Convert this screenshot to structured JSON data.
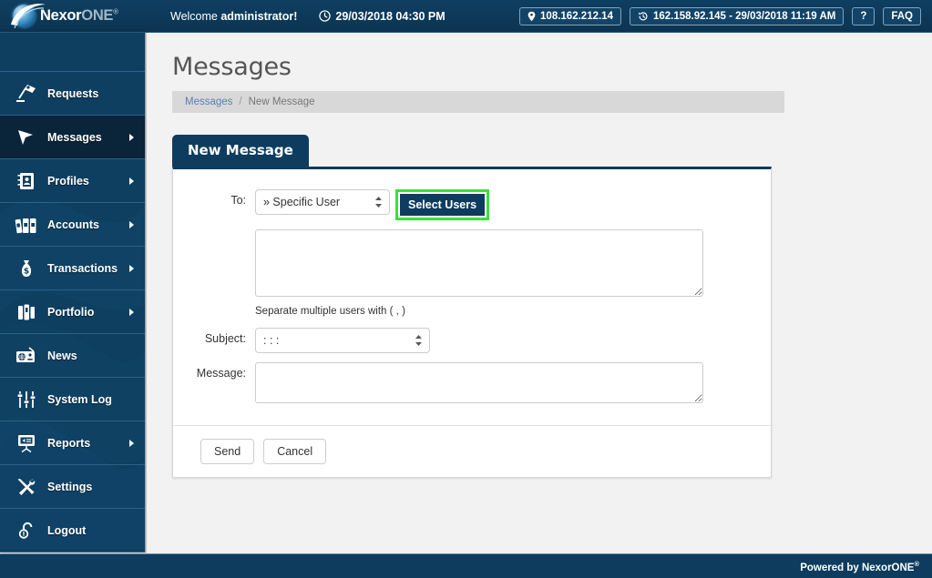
{
  "topbar": {
    "logo_name": "Nexor",
    "logo_name2": "ONE",
    "logo_reg": "®",
    "welcome_prefix": "Welcome ",
    "welcome_user": "administrator!",
    "clock_icon": "clock-icon",
    "datetime": "29/03/2018 04:30 PM",
    "ip_icon": "location-pin-icon",
    "ip_address": "108.162.212.14",
    "last_login_icon": "history-icon",
    "last_login": "162.158.92.145 - 29/03/2018 11:19 AM",
    "help_label": "?",
    "faq_label": "FAQ"
  },
  "sidebar": {
    "items": [
      {
        "label": "Requests",
        "icon": "desk-lamp-icon",
        "arrow": false,
        "active": false
      },
      {
        "label": "Messages",
        "icon": "cursor-arrow-icon",
        "arrow": true,
        "active": true
      },
      {
        "label": "Profiles",
        "icon": "address-book-icon",
        "arrow": true,
        "active": false
      },
      {
        "label": "Accounts",
        "icon": "binders-icon",
        "arrow": true,
        "active": false
      },
      {
        "label": "Transactions",
        "icon": "money-bag-icon",
        "arrow": true,
        "active": false
      },
      {
        "label": "Portfolio",
        "icon": "briefcase-icon",
        "arrow": true,
        "active": false
      },
      {
        "label": "News",
        "icon": "radio-icon",
        "arrow": false,
        "active": false
      },
      {
        "label": "System Log",
        "icon": "sliders-icon",
        "arrow": false,
        "active": false
      },
      {
        "label": "Reports",
        "icon": "presentation-icon",
        "arrow": true,
        "active": false
      },
      {
        "label": "Settings",
        "icon": "tools-icon",
        "arrow": false,
        "active": false
      },
      {
        "label": "Logout",
        "icon": "unlock-icon",
        "arrow": false,
        "active": false
      }
    ]
  },
  "main": {
    "page_title": "Messages",
    "breadcrumb": {
      "root": "Messages",
      "separator": "/",
      "current": "New Message"
    },
    "tab_label": "New Message",
    "form": {
      "to_label": "To:",
      "to_value": "» Specific User",
      "to_options": [
        "» Specific User"
      ],
      "select_users_label": "Select Users",
      "recipients_value": "",
      "recipients_placeholder": "",
      "hint": "Separate multiple users with ( , )",
      "subject_label": "Subject:",
      "subject_value": ": : :",
      "subject_options": [
        ": : :"
      ],
      "message_label": "Message:",
      "message_value": "",
      "message_placeholder": ""
    },
    "send_label": "Send",
    "cancel_label": "Cancel"
  },
  "footer": {
    "powered_by": "Powered by NexorONE",
    "reg": "®"
  },
  "colors": {
    "brand_navy": "#0d3c5e",
    "header_navy": "#0e3e60",
    "sidebar_navy": "#0e3f61",
    "sidebar_active": "#0a2439",
    "highlight_green": "#3ce03c",
    "breadcrumb_link": "#5a7fb5",
    "page_bg": "#f2f2f2"
  }
}
